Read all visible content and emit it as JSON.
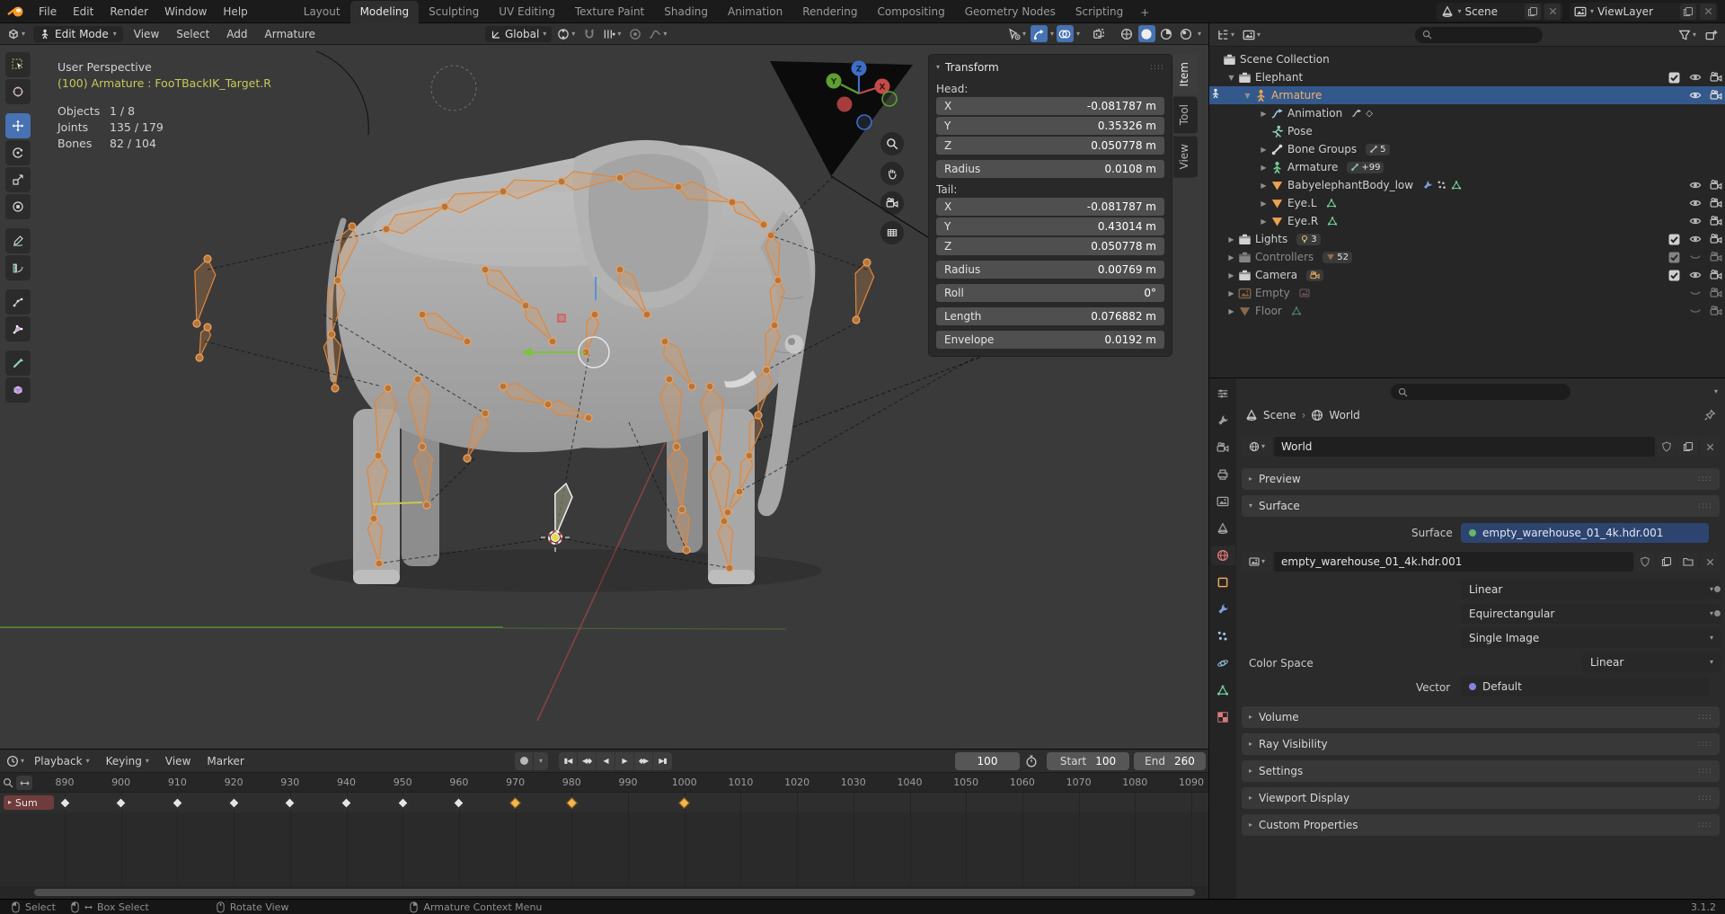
{
  "topbar": {
    "menus": [
      "File",
      "Edit",
      "Render",
      "Window",
      "Help"
    ],
    "workspaces": [
      "Layout",
      "Modeling",
      "Sculpting",
      "UV Editing",
      "Texture Paint",
      "Shading",
      "Animation",
      "Rendering",
      "Compositing",
      "Geometry Nodes",
      "Scripting"
    ],
    "active_workspace": "Modeling",
    "add_workspace": "+",
    "scene_label": "Scene",
    "view_layer_label": "ViewLayer"
  },
  "viewport": {
    "header": {
      "mode": "Edit Mode",
      "menus": [
        "View",
        "Select",
        "Add",
        "Armature"
      ],
      "orientation": "Global"
    },
    "overlay": {
      "view_name": "User Perspective",
      "active_item": "(100) Armature : FooTBackIK_Target.R",
      "stats": [
        {
          "label": "Objects",
          "value": "1 / 8"
        },
        {
          "label": "Joints",
          "value": "135 / 179"
        },
        {
          "label": "Bones",
          "value": "82 / 104"
        }
      ]
    },
    "gizmo_axes": {
      "x": "X",
      "y": "Y",
      "z": "Z"
    }
  },
  "toolbar": {
    "active_tool": "move",
    "tools": [
      "select-box",
      "cursor-3d",
      "move",
      "rotate",
      "scale",
      "transform",
      "annotate",
      "measure",
      "roll",
      "bone-envelope",
      "extrude",
      "primitive-cube"
    ]
  },
  "transform_panel": {
    "title": "Transform",
    "tabs": [
      "Item",
      "Tool",
      "View"
    ],
    "active_tab": "Item",
    "head_label": "Head:",
    "tail_label": "Tail:",
    "head": [
      {
        "label": "X",
        "value": "-0.081787 m"
      },
      {
        "label": "Y",
        "value": "0.35326 m"
      },
      {
        "label": "Z",
        "value": "0.050778 m"
      },
      {
        "label": "Radius",
        "value": "0.0108 m"
      }
    ],
    "tail": [
      {
        "label": "X",
        "value": "-0.081787 m"
      },
      {
        "label": "Y",
        "value": "0.43014 m"
      },
      {
        "label": "Z",
        "value": "0.050778 m"
      },
      {
        "label": "Radius",
        "value": "0.00769 m"
      },
      {
        "label": "Roll",
        "value": "0°"
      },
      {
        "label": "Length",
        "value": "0.076882 m"
      },
      {
        "label": "Envelope",
        "value": "0.0192 m"
      }
    ]
  },
  "outliner": {
    "rows": [
      {
        "label": "Scene Collection"
      },
      {
        "label": "Elephant"
      },
      {
        "label": "Armature"
      },
      {
        "label": "Animation"
      },
      {
        "label": "Pose"
      },
      {
        "label": "Bone Groups",
        "count": "5"
      },
      {
        "label": "Armature",
        "count": "+99"
      },
      {
        "label": "BabyelephantBody_low"
      },
      {
        "label": "Eye.L"
      },
      {
        "label": "Eye.R"
      },
      {
        "label": "Lights",
        "count": "3"
      },
      {
        "label": "Controllers",
        "count": "52"
      },
      {
        "label": "Camera"
      },
      {
        "label": "Empty"
      },
      {
        "label": "Floor"
      }
    ]
  },
  "properties": {
    "breadcrumb": [
      "Scene",
      "World"
    ],
    "datablock": "World",
    "tabs": [
      "tool",
      "render",
      "output",
      "view-layer",
      "scene",
      "world",
      "object",
      "modifiers",
      "particles",
      "physics",
      "object-data",
      "texture"
    ],
    "active_tab": "world",
    "panels": {
      "preview": "Preview",
      "surface": "Surface",
      "volume": "Volume",
      "ray": "Ray Visibility",
      "settings": "Settings",
      "viewport_display": "Viewport Display",
      "custom": "Custom Properties"
    },
    "surface": {
      "label": "Surface",
      "value": "empty_warehouse_01_4k.hdr.001",
      "image_name": "empty_warehouse_01_4k.hdr.001",
      "interpolation": "Linear",
      "projection": "Equirectangular",
      "source": "Single Image",
      "color_space_label": "Color Space",
      "color_space": "Linear",
      "vector_label": "Vector",
      "vector": "Default"
    }
  },
  "timeline": {
    "menus": [
      "Playback",
      "Keying",
      "View",
      "Marker"
    ],
    "current_frame": "100",
    "start_label": "Start",
    "start_value": "100",
    "end_label": "End",
    "end_value": "260",
    "channel": "Sum",
    "ruler_start": 890,
    "ruler_end": 1090,
    "ruler_step": 10,
    "keyframes": [
      {
        "frame": 890,
        "selected": false
      },
      {
        "frame": 900,
        "selected": false
      },
      {
        "frame": 910,
        "selected": false
      },
      {
        "frame": 920,
        "selected": false
      },
      {
        "frame": 930,
        "selected": false
      },
      {
        "frame": 940,
        "selected": false
      },
      {
        "frame": 950,
        "selected": false
      },
      {
        "frame": 960,
        "selected": false
      },
      {
        "frame": 970,
        "selected": true
      },
      {
        "frame": 980,
        "selected": true
      },
      {
        "frame": 1000,
        "selected": true
      }
    ]
  },
  "statusbar": {
    "hints": [
      "Select",
      "Box Select",
      "Rotate View",
      "Armature Context Menu"
    ],
    "version": "3.1.2"
  },
  "colors": {
    "accent": "#4772b3",
    "selection_row": "#33598c",
    "bone_orange": "#e0873c",
    "keyframe_selected": "#f2b64b"
  }
}
